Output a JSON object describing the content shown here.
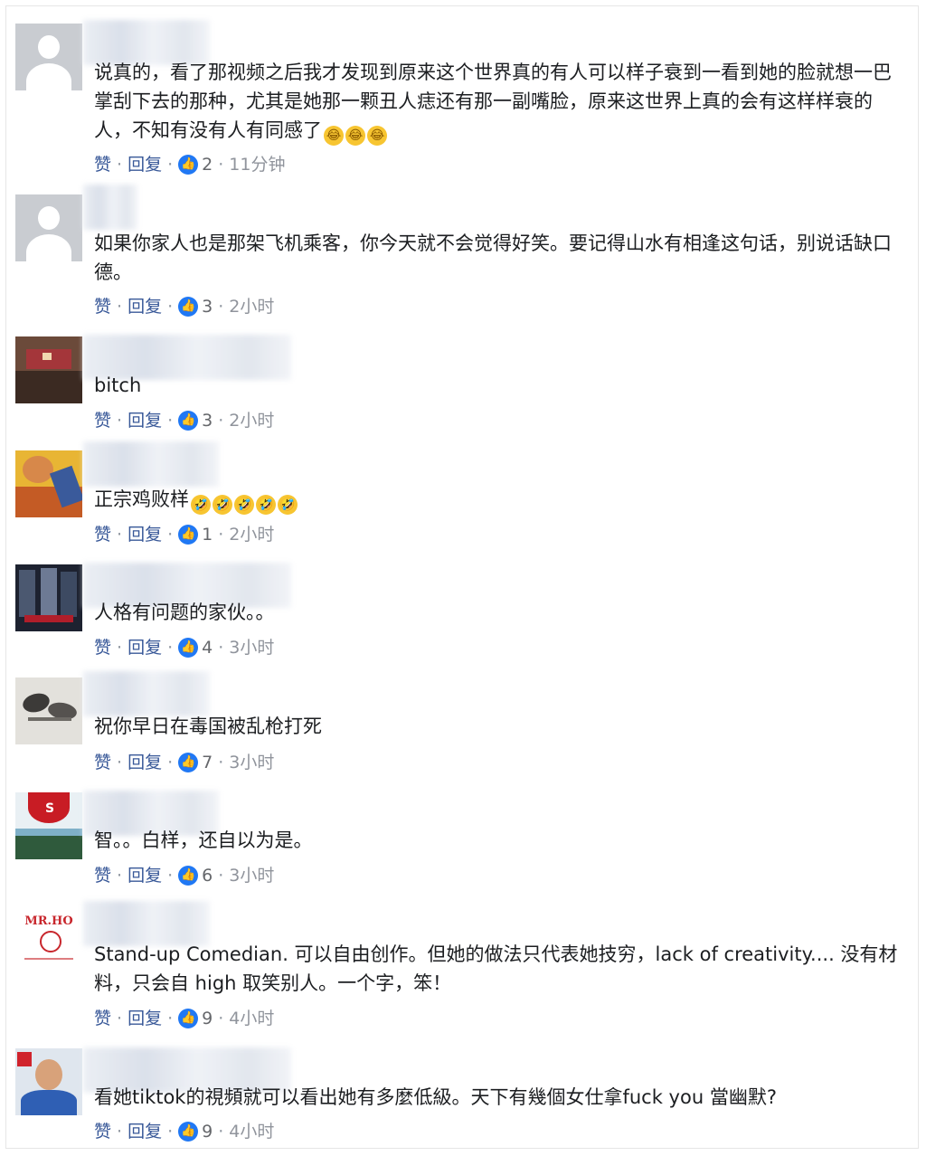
{
  "meta_labels": {
    "like": "赞",
    "reply": "回复",
    "sep": "·"
  },
  "comments": [
    {
      "avatar": "default-avatar",
      "text": "说真的，看了那视频之后我才发现到原来这个世界真的有人可以样子衰到一看到她的脸就想一巴掌刮下去的那种，尤其是她那一颗丑人痣还有那一副嘴脸，原来这世界上真的会有这样样衰的人，不知有没有人有同感了",
      "emojis": [
        "😂",
        "😂",
        "😂"
      ],
      "likes": "2",
      "time": "11分钟"
    },
    {
      "avatar": "default-avatar",
      "text": "如果你家人也是那架飞机乘客，你今天就不会觉得好笑。要记得山水有相逢这句话，别说话缺口德。",
      "emojis": [],
      "likes": "3",
      "time": "2小时"
    },
    {
      "avatar": "room-photo-avatar",
      "text": "bitch",
      "emojis": [],
      "likes": "3",
      "time": "2小时"
    },
    {
      "avatar": "comic-avatar",
      "text": "正宗鸡败样",
      "emojis": [
        "🤣",
        "🤣",
        "🤣",
        "🤣",
        "🤣"
      ],
      "likes": "1",
      "time": "2小时"
    },
    {
      "avatar": "movie-poster-avatar",
      "text": "人格有问题的家伙。。",
      "emojis": [],
      "likes": "4",
      "time": "3小时"
    },
    {
      "avatar": "horse-painting-avatar",
      "text": "祝你早日在毒国被乱枪打死",
      "emojis": [],
      "likes": "7",
      "time": "3小时"
    },
    {
      "avatar": "nature-logo-avatar",
      "text": "智。。白样，还自以为是。",
      "emojis": [],
      "likes": "6",
      "time": "3小时"
    },
    {
      "avatar": "mr-ho-logo-avatar",
      "brand": "MR.HO",
      "text": "Stand-up Comedian. 可以自由创作。但她的做法只代表她技穷，lack of creativity.... 没有材料，只会自 high 取笑别人。一个字，笨！",
      "emojis": [],
      "likes": "9",
      "time": "4小时"
    },
    {
      "avatar": "man-photo-avatar",
      "text": "看她tiktok的視頻就可以看出她有多麼低級。天下有幾個女仕拿fuck you 當幽默?",
      "emojis": [],
      "likes": "9",
      "time": "4小时"
    }
  ]
}
